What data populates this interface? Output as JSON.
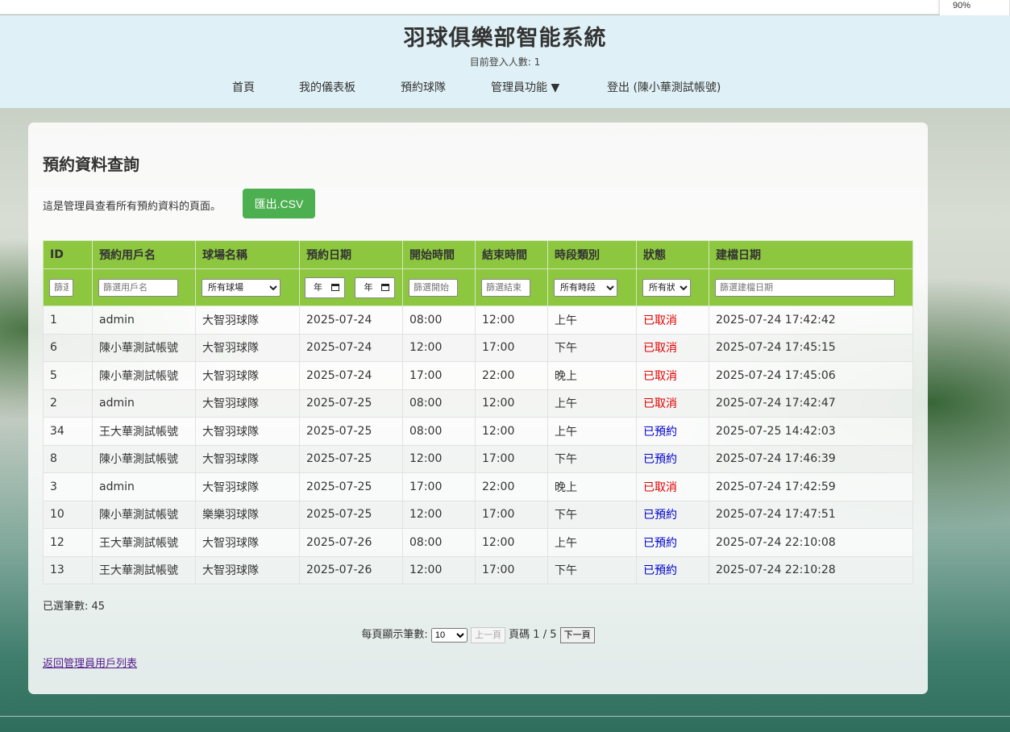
{
  "browser": {
    "zoom": "90%"
  },
  "header": {
    "title": "羽球俱樂部智能系統",
    "online_text": "目前登入人數: 1",
    "nav": [
      {
        "label": "首頁"
      },
      {
        "label": "我的儀表板"
      },
      {
        "label": "預約球隊"
      },
      {
        "label": "管理員功能 ▼"
      },
      {
        "label": "登出 (陳小華測試帳號)"
      }
    ]
  },
  "page": {
    "title": "預約資料查詢",
    "description": "這是管理員查看所有預約資料的頁面。",
    "export_label": "匯出.CSV"
  },
  "table": {
    "columns": [
      "ID",
      "預約用戶名",
      "球場名稱",
      "預約日期",
      "開始時間",
      "結束時間",
      "時段類別",
      "狀態",
      "建檔日期"
    ],
    "filters": {
      "id_placeholder": "篩選",
      "user_placeholder": "篩選用戶名",
      "court_select": "所有球場",
      "date_from": "年",
      "date_to": "年",
      "start_placeholder": "篩選開始",
      "end_placeholder": "篩選結束",
      "period_select": "所有時段",
      "status_select": "所有狀",
      "created_placeholder": "篩選建檔日期"
    },
    "rows": [
      {
        "id": "1",
        "user": "admin",
        "court": "大智羽球隊",
        "date": "2025-07-24",
        "start": "08:00",
        "end": "12:00",
        "period": "上午",
        "status": "已取消",
        "status_color": "#e00000",
        "created": "2025-07-24 17:42:42"
      },
      {
        "id": "6",
        "user": "陳小華測試帳號",
        "court": "大智羽球隊",
        "date": "2025-07-24",
        "start": "12:00",
        "end": "17:00",
        "period": "下午",
        "status": "已取消",
        "status_color": "#e00000",
        "created": "2025-07-24 17:45:15"
      },
      {
        "id": "5",
        "user": "陳小華測試帳號",
        "court": "大智羽球隊",
        "date": "2025-07-24",
        "start": "17:00",
        "end": "22:00",
        "period": "晚上",
        "status": "已取消",
        "status_color": "#e00000",
        "created": "2025-07-24 17:45:06"
      },
      {
        "id": "2",
        "user": "admin",
        "court": "大智羽球隊",
        "date": "2025-07-25",
        "start": "08:00",
        "end": "12:00",
        "period": "上午",
        "status": "已取消",
        "status_color": "#e00000",
        "created": "2025-07-24 17:42:47"
      },
      {
        "id": "34",
        "user": "王大華測試帳號",
        "court": "大智羽球隊",
        "date": "2025-07-25",
        "start": "08:00",
        "end": "12:00",
        "period": "上午",
        "status": "已預約",
        "status_color": "#0000cc",
        "created": "2025-07-25 14:42:03"
      },
      {
        "id": "8",
        "user": "陳小華測試帳號",
        "court": "大智羽球隊",
        "date": "2025-07-25",
        "start": "12:00",
        "end": "17:00",
        "period": "下午",
        "status": "已預約",
        "status_color": "#0000cc",
        "created": "2025-07-24 17:46:39"
      },
      {
        "id": "3",
        "user": "admin",
        "court": "大智羽球隊",
        "date": "2025-07-25",
        "start": "17:00",
        "end": "22:00",
        "period": "晚上",
        "status": "已取消",
        "status_color": "#e00000",
        "created": "2025-07-24 17:42:59"
      },
      {
        "id": "10",
        "user": "陳小華測試帳號",
        "court": "樂樂羽球隊",
        "date": "2025-07-25",
        "start": "12:00",
        "end": "17:00",
        "period": "下午",
        "status": "已預約",
        "status_color": "#0000cc",
        "created": "2025-07-24 17:47:51"
      },
      {
        "id": "12",
        "user": "王大華測試帳號",
        "court": "大智羽球隊",
        "date": "2025-07-26",
        "start": "08:00",
        "end": "12:00",
        "period": "上午",
        "status": "已預約",
        "status_color": "#0000cc",
        "created": "2025-07-24 22:10:08"
      },
      {
        "id": "13",
        "user": "王大華測試帳號",
        "court": "大智羽球隊",
        "date": "2025-07-26",
        "start": "12:00",
        "end": "17:00",
        "period": "下午",
        "status": "已預約",
        "status_color": "#0000cc",
        "created": "2025-07-24 22:10:28"
      }
    ]
  },
  "summary": {
    "selected_count": "已選筆數: 45"
  },
  "pagination": {
    "per_page_label": "每頁顯示筆數:",
    "per_page_value": "10",
    "prev_label": "上一頁",
    "page_info": "頁碼 1 / 5",
    "next_label": "下一頁"
  },
  "back_link": "返回管理員用戶列表",
  "colors": {
    "header_bg": "#dff0f6",
    "table_header": "#8dc63f",
    "export_button": "#4caf50",
    "cancelled": "#e00000",
    "booked": "#0000cc"
  }
}
